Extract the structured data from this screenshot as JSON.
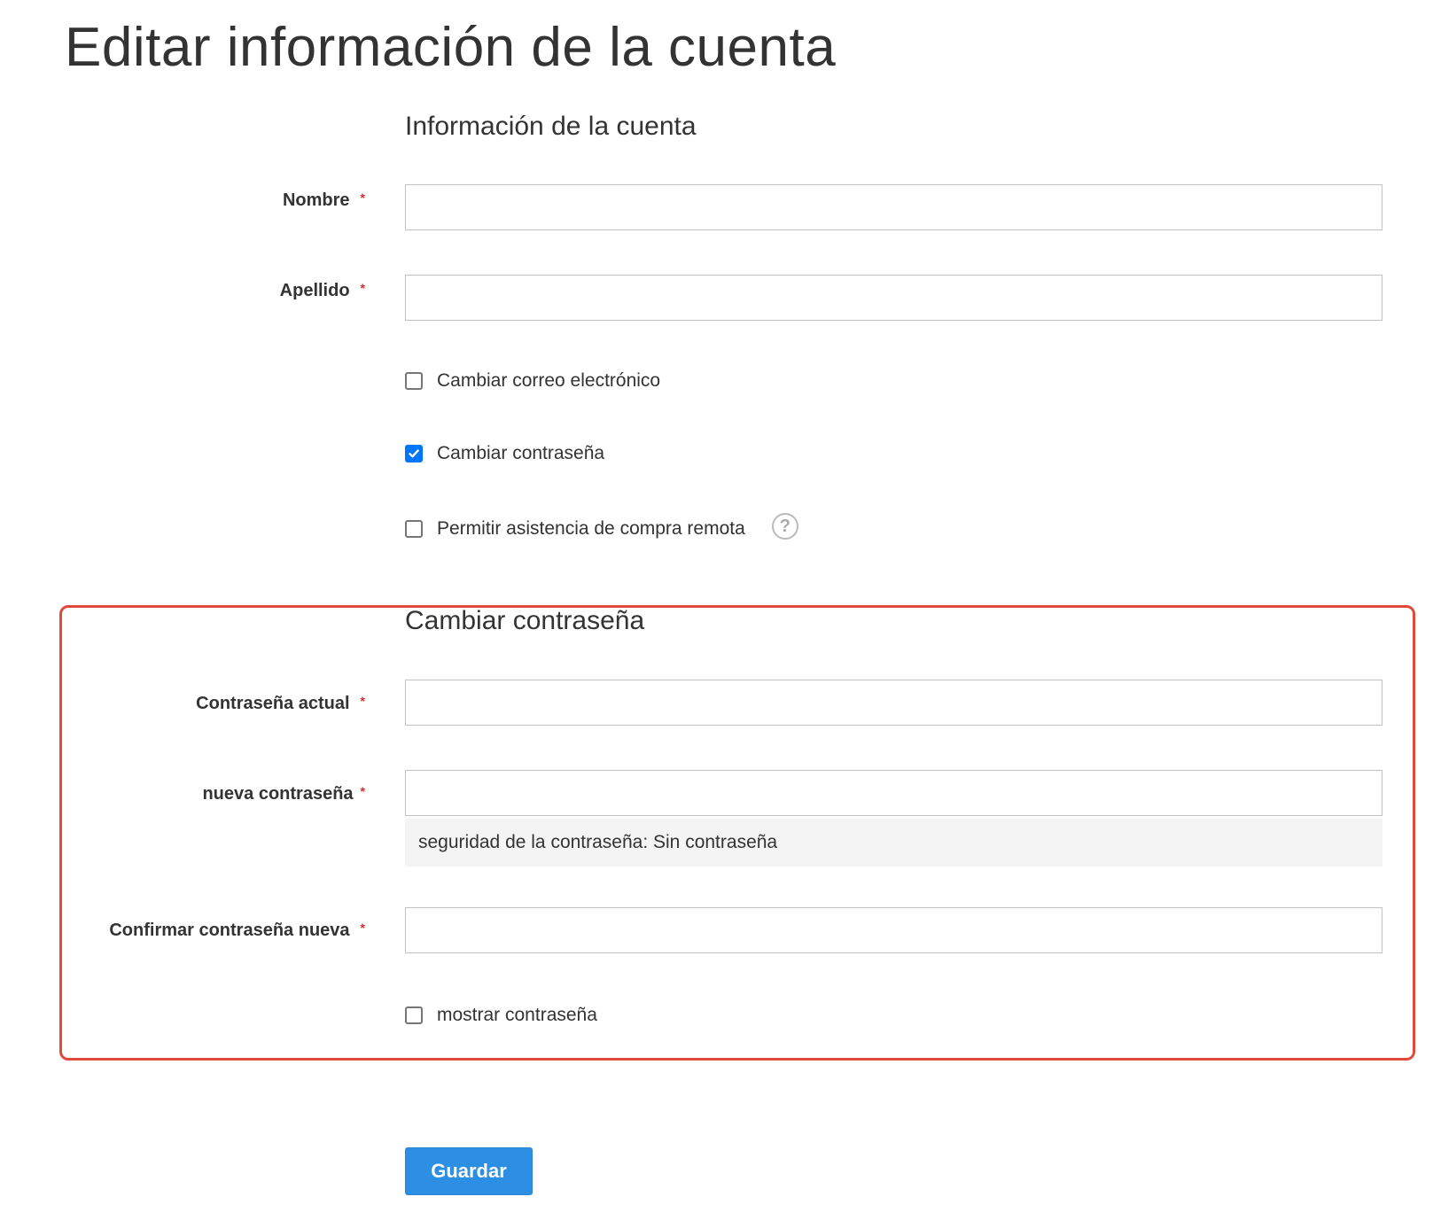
{
  "page": {
    "title": "Editar información de la cuenta"
  },
  "account_info": {
    "section_title": "Información de la cuenta",
    "first_name": {
      "label": "Nombre",
      "required_mark": "*",
      "value": ""
    },
    "last_name": {
      "label": "Apellido",
      "required_mark": "*",
      "value": ""
    },
    "change_email": {
      "label": "Cambiar correo electrónico",
      "checked": false
    },
    "change_password": {
      "label": "Cambiar contraseña",
      "checked": true
    },
    "remote_assistance": {
      "label": "Permitir asistencia de compra remota",
      "checked": false,
      "help_icon": "question-mark-icon",
      "help_glyph": "?"
    }
  },
  "change_password_section": {
    "section_title": "Cambiar contraseña",
    "highlight_color": "#e04a3a",
    "current_password": {
      "label": "Contraseña actual",
      "required_mark": "*",
      "value": ""
    },
    "new_password": {
      "label": "nueva contraseña",
      "required_mark": "*",
      "value": ""
    },
    "strength_meter": {
      "text": "seguridad de la contraseña: Sin contraseña"
    },
    "confirm_password": {
      "label": "Confirmar contraseña nueva",
      "required_mark": "*",
      "value": ""
    },
    "show_password": {
      "label": "mostrar contraseña",
      "checked": false
    }
  },
  "actions": {
    "save_label": "Guardar",
    "save_color": "#2d8fe4"
  },
  "colors": {
    "required": "#e02b27",
    "checkbox_checked": "#0075ff",
    "text": "#333333"
  }
}
